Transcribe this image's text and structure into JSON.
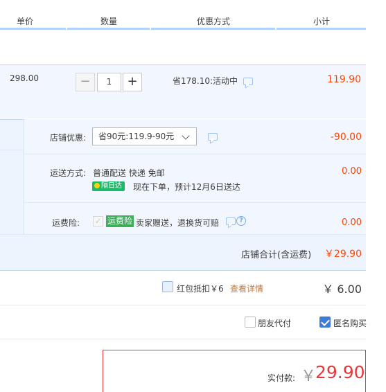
{
  "header": {
    "col_unit_price": "单价",
    "col_quantity": "数量",
    "col_promo": "优惠方式",
    "col_subtotal": "小计"
  },
  "item": {
    "unit_price": "298.00",
    "quantity": "1",
    "minus_label": "−",
    "plus_label": "+",
    "promo": "省178.10:活动中",
    "subtotal": "119.90"
  },
  "shop": {
    "discount_label": "店铺优惠:",
    "discount_selected": "省90元:119.9-90元",
    "discount_amount": "-90.00",
    "shipping_label": "运送方式:",
    "shipping_method": "普通配送 快递 免邮",
    "shipping_badge": "隔日达",
    "shipping_eta": "现在下单，预计12月6日送达",
    "shipping_amount": "0.00",
    "insurance_label": "运费险:",
    "insurance_checkmark": "✓",
    "insurance_badge": "运费险",
    "insurance_desc": "卖家赠送，退换货可赔",
    "insurance_help": "?",
    "insurance_amount": "0.00",
    "total_label": "店铺合计(含运费)",
    "total_amount": "￥29.90"
  },
  "redpacket": {
    "label": "红包抵扣￥6",
    "details_link": "查看详情",
    "amount": "￥ 6.00"
  },
  "options": {
    "friend_pay": "朋友代付",
    "friend_pay_checked": false,
    "anonymous": "匿名购买",
    "anonymous_checked": true
  },
  "payment": {
    "label": "实付款:",
    "currency": "￥",
    "amount": "29.90"
  },
  "colors": {
    "accent_red": "#ff4400",
    "header_line": "#b2d1ff",
    "badge_green": "#1cb96b",
    "link_brown": "#c1773c"
  }
}
